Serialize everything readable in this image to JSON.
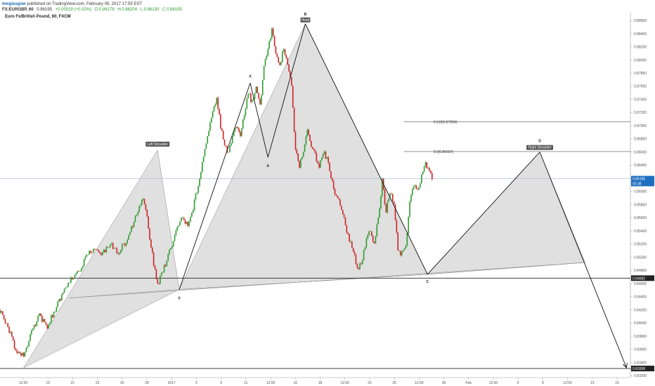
{
  "header": {
    "user": "lewglasgow",
    "published": "published on TradingView.com, February 06, 2017 17:59 EST",
    "symbol": "FX:EURGBP, 60",
    "last": "0.86195",
    "change": "+0.00019 (+0.02%)",
    "ohlc": [
      "O:0.86178",
      "H:0.86204",
      "L:0.86130",
      "C:0.86195"
    ]
  },
  "colors": {
    "up": "#2e9a2e",
    "down": "#cc2222",
    "fill": "#d6d6d6",
    "accent": "#1e6fbf"
  },
  "chart_data": {
    "type": "candlestick",
    "title": "Euro Fx/British Pound, 60, FXCM",
    "ylim": [
      0.8317,
      0.8872
    ],
    "yticks": [
      "0.88600",
      "0.88400",
      "0.88200",
      "0.88000",
      "0.87800",
      "0.87600",
      "0.87400",
      "0.87200",
      "0.87000",
      "0.86800",
      "0.86600",
      "0.86400",
      "0.86200",
      "0.86000",
      "0.85800",
      "0.85600",
      "0.85400",
      "0.85200",
      "0.85000",
      "0.84800",
      "0.84600",
      "0.84400",
      "0.84200",
      "0.84000",
      "0.83800",
      "0.83600",
      "0.83400",
      "0.83200"
    ],
    "xticks": [
      "12:00",
      "19",
      "21",
      "23",
      "26",
      "28",
      "2017",
      "5",
      "9",
      "11",
      "12:00",
      "16",
      "18",
      "12:00",
      "23",
      "25",
      "12:00",
      "30",
      "Feb",
      "12:00",
      "6",
      "8",
      "12:00",
      "13",
      "15"
    ],
    "price_tags": [
      {
        "text": "0.86195",
        "value": 0.86195,
        "color": "#1e6fbf"
      },
      {
        "text": "00:38",
        "value": 0.86122,
        "color": "#1e6fbf"
      },
      {
        "text": "0.84682",
        "value": 0.84682,
        "color": "#222222"
      },
      {
        "text": "0.83308",
        "value": 0.83308,
        "color": "#222222"
      }
    ],
    "horizontal_lines": [
      0.84682,
      0.83308,
      0.86195
    ],
    "fib_levels": [
      {
        "label": "0.618(0.87058)",
        "value": 0.87058
      },
      {
        "label": "0.5(0.86607)",
        "value": 0.86607
      }
    ],
    "points": {
      "start": 0.8332,
      "ls": 0.8663,
      "o": 0.8451,
      "x": 0.8765,
      "a": 0.8652,
      "b": 0.8855,
      "c": 0.8474,
      "d": 0.866,
      "target": 0.8332
    },
    "point_labels": [
      "X",
      "A",
      "B",
      "C",
      "D",
      "0"
    ],
    "annotations": [
      "Left Shoulder",
      "Head",
      "Right Shoulder"
    ],
    "price_path": [
      [
        0,
        0.842
      ],
      [
        4,
        0.8395
      ],
      [
        8,
        0.836
      ],
      [
        12,
        0.8352
      ],
      [
        16,
        0.8385
      ],
      [
        20,
        0.8412
      ],
      [
        24,
        0.8395
      ],
      [
        28,
        0.842
      ],
      [
        32,
        0.8448
      ],
      [
        36,
        0.8465
      ],
      [
        40,
        0.8478
      ],
      [
        44,
        0.8502
      ],
      [
        48,
        0.8515
      ],
      [
        52,
        0.8505
      ],
      [
        56,
        0.852
      ],
      [
        60,
        0.8508
      ],
      [
        64,
        0.8525
      ],
      [
        68,
        0.8555
      ],
      [
        72,
        0.859
      ],
      [
        74,
        0.8575
      ],
      [
        76,
        0.853
      ],
      [
        78,
        0.849
      ],
      [
        80,
        0.8458
      ],
      [
        84,
        0.849
      ],
      [
        88,
        0.8525
      ],
      [
        92,
        0.856
      ],
      [
        96,
        0.855
      ],
      [
        100,
        0.86
      ],
      [
        104,
        0.8665
      ],
      [
        108,
        0.872
      ],
      [
        110,
        0.8745
      ],
      [
        112,
        0.87
      ],
      [
        114,
        0.867
      ],
      [
        116,
        0.866
      ],
      [
        118,
        0.8685
      ],
      [
        120,
        0.87
      ],
      [
        122,
        0.868
      ],
      [
        124,
        0.872
      ],
      [
        126,
        0.875
      ],
      [
        128,
        0.8735
      ],
      [
        130,
        0.876
      ],
      [
        132,
        0.873
      ],
      [
        134,
        0.879
      ],
      [
        136,
        0.882
      ],
      [
        138,
        0.8845
      ],
      [
        140,
        0.881
      ],
      [
        142,
        0.879
      ],
      [
        144,
        0.882
      ],
      [
        146,
        0.879
      ],
      [
        148,
        0.876
      ],
      [
        150,
        0.866
      ],
      [
        152,
        0.864
      ],
      [
        154,
        0.866
      ],
      [
        156,
        0.869
      ],
      [
        158,
        0.867
      ],
      [
        160,
        0.8655
      ],
      [
        162,
        0.864
      ],
      [
        164,
        0.866
      ],
      [
        166,
        0.865
      ],
      [
        168,
        0.862
      ],
      [
        170,
        0.86
      ],
      [
        172,
        0.8585
      ],
      [
        174,
        0.8565
      ],
      [
        176,
        0.854
      ],
      [
        178,
        0.852
      ],
      [
        180,
        0.85
      ],
      [
        182,
        0.848
      ],
      [
        184,
        0.85
      ],
      [
        186,
        0.8525
      ],
      [
        188,
        0.854
      ],
      [
        190,
        0.852
      ],
      [
        192,
        0.856
      ],
      [
        194,
        0.8615
      ],
      [
        196,
        0.857
      ],
      [
        198,
        0.86
      ],
      [
        200,
        0.858
      ],
      [
        202,
        0.851
      ],
      [
        204,
        0.8505
      ],
      [
        206,
        0.852
      ],
      [
        208,
        0.858
      ],
      [
        210,
        0.861
      ],
      [
        212,
        0.86
      ],
      [
        214,
        0.8625
      ],
      [
        216,
        0.864
      ],
      [
        218,
        0.8628
      ],
      [
        220,
        0.862
      ]
    ]
  }
}
